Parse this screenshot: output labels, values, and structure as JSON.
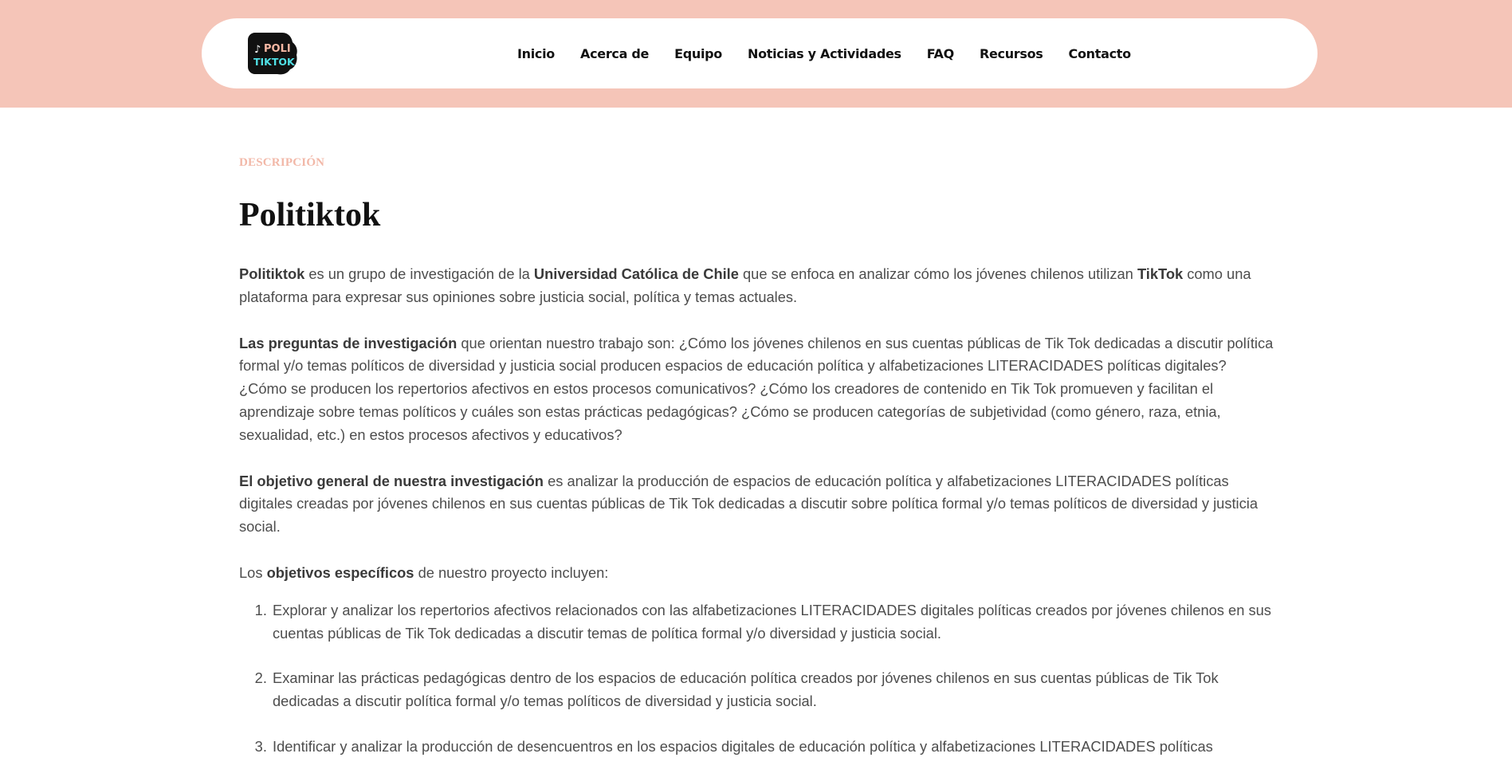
{
  "header": {
    "logo": {
      "text_line1": "POLI",
      "text_line2": "TIKTOK",
      "icon": "tiktok-note-icon"
    },
    "nav": [
      {
        "label": "Inicio"
      },
      {
        "label": "Acerca de"
      },
      {
        "label": "Equipo"
      },
      {
        "label": "Noticias y Actividades"
      },
      {
        "label": "FAQ"
      },
      {
        "label": "Recursos"
      },
      {
        "label": "Contacto"
      }
    ]
  },
  "main": {
    "eyebrow": "DESCRIPCIÓN",
    "title": "Politiktok",
    "p1": {
      "b1": "Politiktok",
      "t1": " es un grupo de investigación de la ",
      "b2": "Universidad Católica de Chile",
      "t2": " que se enfoca en analizar cómo los jóvenes chilenos utilizan ",
      "b3": "TikTok",
      "t3": " como una plataforma para expresar sus opiniones sobre justicia social, política y temas actuales."
    },
    "p2": {
      "b1": "Las preguntas de investigación",
      "t1": " que orientan nuestro trabajo son: ¿Cómo los jóvenes chilenos en sus cuentas públicas de Tik Tok dedicadas a discutir política formal y/o temas políticos de diversidad y justicia social producen espacios de educación política y alfabetizaciones LITERACIDADES políticas digitales? ¿Cómo se producen los repertorios afectivos en estos procesos comunicativos? ¿Cómo los creadores de contenido en Tik Tok promueven y facilitan el aprendizaje sobre temas políticos y cuáles son estas prácticas pedagógicas? ¿Cómo se producen categorías de subjetividad (como género, raza, etnia, sexualidad, etc.) en estos procesos afectivos y educativos?"
    },
    "p3": {
      "b1": "El objetivo general de nuestra investigación",
      "t1": " es analizar la producción de espacios de educación política y alfabetizaciones LITERACIDADES políticas digitales creadas por jóvenes chilenos en sus cuentas públicas de Tik Tok dedicadas a discutir sobre política formal y/o temas políticos de diversidad y justicia social."
    },
    "p4": {
      "t0": "Los ",
      "b1": "objetivos específicos",
      "t1": " de nuestro proyecto incluyen:"
    },
    "objectives": [
      "Explorar y analizar los repertorios afectivos relacionados con las alfabetizaciones LITERACIDADES digitales políticas creados por jóvenes chilenos en sus cuentas públicas de Tik Tok dedicadas a discutir temas de política formal y/o diversidad y justicia social.",
      "Examinar las prácticas pedagógicas dentro de los espacios de educación política creados por jóvenes chilenos en sus cuentas públicas de Tik Tok dedicadas a discutir política formal y/o temas políticos de diversidad y justicia social.",
      "Identificar y analizar la producción de desencuentros en los espacios digitales de educación política y alfabetizaciones LITERACIDADES políticas"
    ]
  },
  "colors": {
    "header_band": "#f5c5b8",
    "eyebrow": "#f2b8a8",
    "logo_bg": "#111111",
    "logo_line1": "#f7b7a3",
    "logo_line2": "#4fe0e6"
  }
}
